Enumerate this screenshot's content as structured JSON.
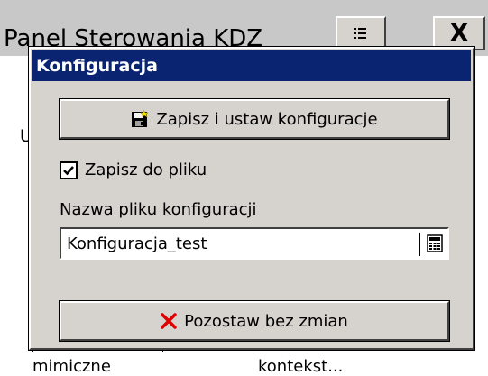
{
  "background": {
    "window_title": "Panel Sterowania KDZ",
    "side_letter": "U",
    "bottom_labels": [
      "mimiczne",
      "kontekst..."
    ],
    "close_label": "X"
  },
  "dialog": {
    "title": "Konfiguracja",
    "save_button_label": "Zapisz i ustaw konfiguracje",
    "checkbox_label": "Zapisz do pliku",
    "checkbox_checked": true,
    "field_label": "Nazwa pliku konfiguracji",
    "filename_value": "Konfiguracja_test",
    "leave_button_label": "Pozostaw bez zmian"
  },
  "colors": {
    "titlebar": "#0a2472",
    "face": "#d6d3ce",
    "cancel_x": "#e00000"
  },
  "icons": [
    "menu-icon",
    "floppy-disk-icon",
    "check-icon",
    "calculator-icon",
    "red-x-icon"
  ]
}
